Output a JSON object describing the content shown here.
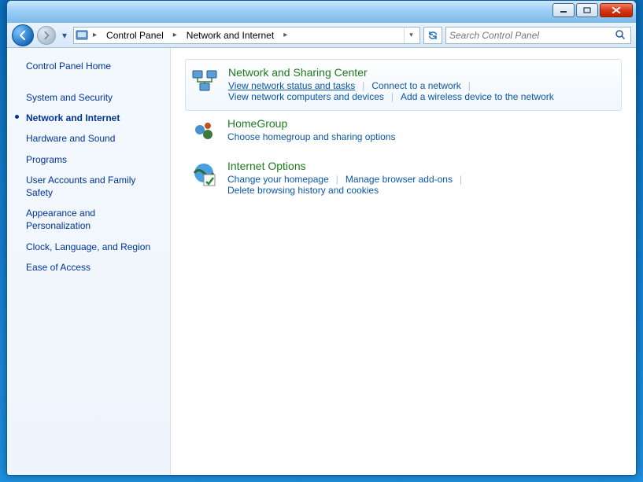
{
  "breadcrumb": {
    "root": "Control Panel",
    "current": "Network and Internet"
  },
  "search": {
    "placeholder": "Search Control Panel"
  },
  "sidebar": {
    "home": "Control Panel Home",
    "items": [
      {
        "label": "System and Security",
        "active": false
      },
      {
        "label": "Network and Internet",
        "active": true
      },
      {
        "label": "Hardware and Sound",
        "active": false
      },
      {
        "label": "Programs",
        "active": false
      },
      {
        "label": "User Accounts and Family Safety",
        "active": false
      },
      {
        "label": "Appearance and Personalization",
        "active": false
      },
      {
        "label": "Clock, Language, and Region",
        "active": false
      },
      {
        "label": "Ease of Access",
        "active": false
      }
    ]
  },
  "categories": [
    {
      "title": "Network and Sharing Center",
      "links": [
        "View network status and tasks",
        "Connect to a network",
        "View network computers and devices",
        "Add a wireless device to the network"
      ]
    },
    {
      "title": "HomeGroup",
      "links": [
        "Choose homegroup and sharing options"
      ]
    },
    {
      "title": "Internet Options",
      "links": [
        "Change your homepage",
        "Manage browser add-ons",
        "Delete browsing history and cookies"
      ]
    }
  ]
}
